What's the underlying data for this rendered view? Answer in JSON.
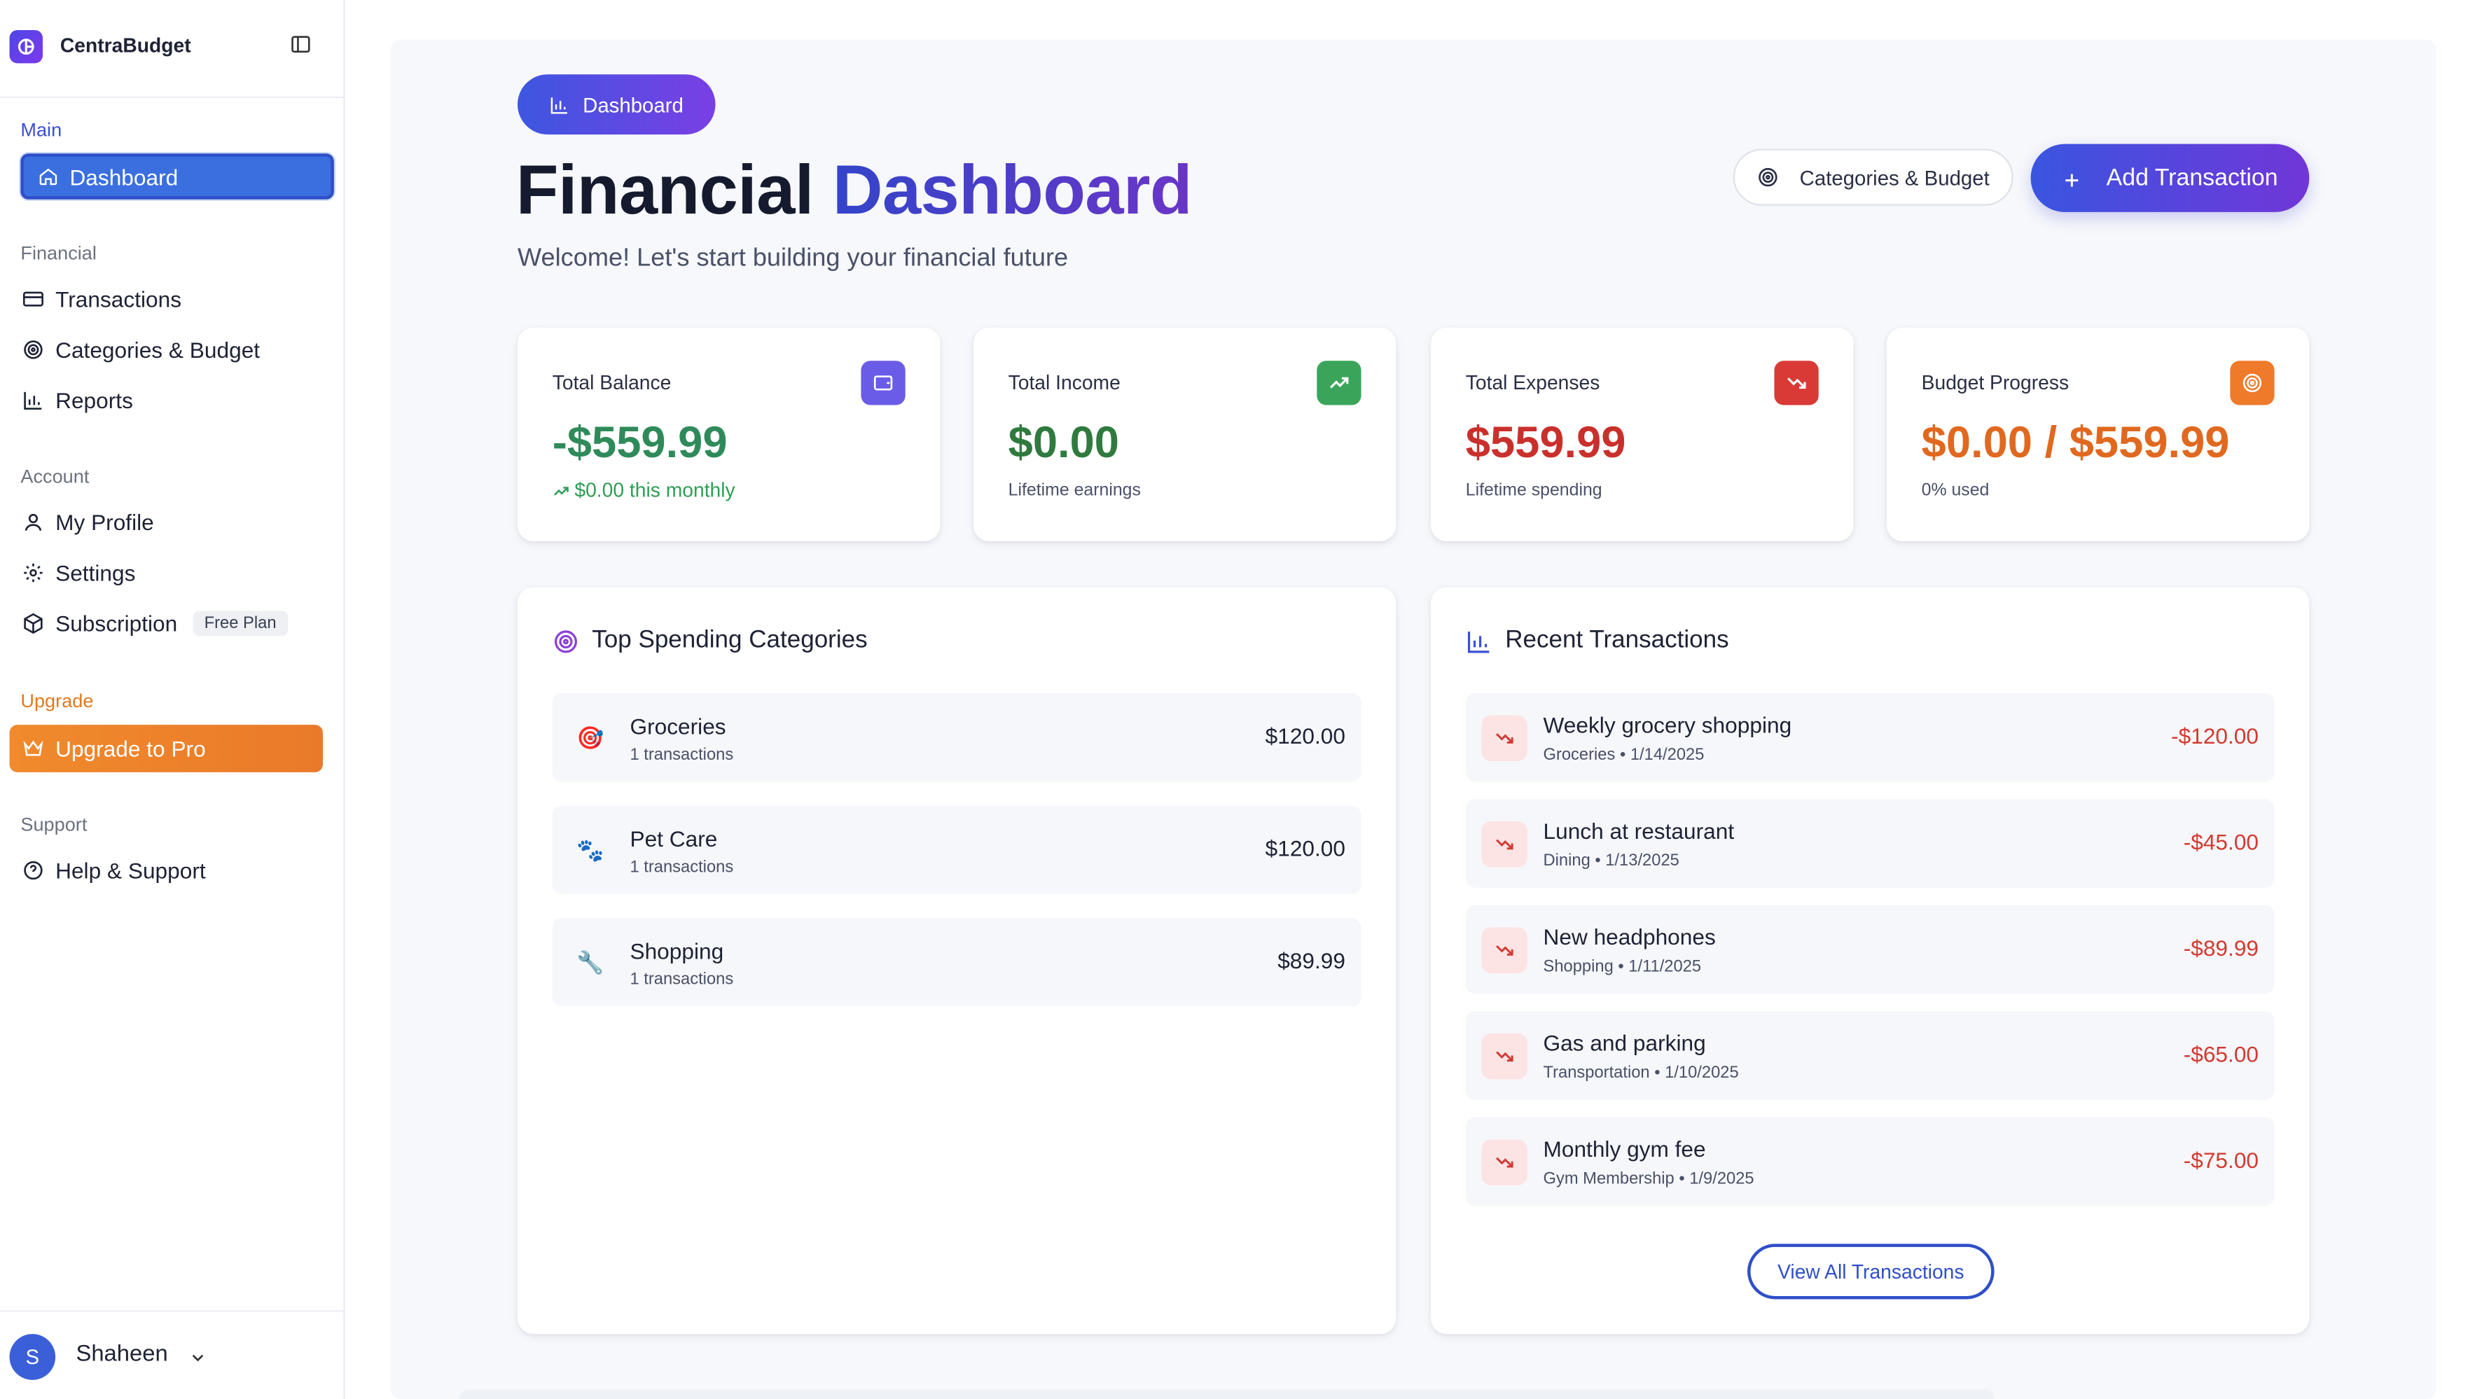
{
  "brand": {
    "name": "CentraBudget"
  },
  "sidebar": {
    "sections": {
      "main": "Main",
      "financial": "Financial",
      "account": "Account",
      "upgrade": "Upgrade",
      "support": "Support"
    },
    "items": {
      "dashboard": "Dashboard",
      "transactions": "Transactions",
      "categories": "Categories & Budget",
      "reports": "Reports",
      "profile": "My Profile",
      "settings": "Settings",
      "subscription": "Subscription",
      "subscription_badge": "Free Plan",
      "upgrade": "Upgrade to Pro",
      "help": "Help & Support"
    },
    "user": {
      "initial": "S",
      "name": "Shaheen"
    }
  },
  "header": {
    "pill": "Dashboard",
    "title_part1": "Financial",
    "title_part2": "Dashboard",
    "subtitle": "Welcome! Let's start building your financial future",
    "categories_button": "Categories & Budget",
    "add_button": "Add Transaction"
  },
  "stats": [
    {
      "label": "Total Balance",
      "value": "-$559.99",
      "sub": "$0.00 this monthly",
      "color": "#2f8a5a",
      "icon_color": "#6b5ce7"
    },
    {
      "label": "Total Income",
      "value": "$0.00",
      "sub": "Lifetime earnings",
      "color": "#2f7a3e",
      "icon_color": "#3aa55a"
    },
    {
      "label": "Total Expenses",
      "value": "$559.99",
      "sub": "Lifetime spending",
      "color": "#c9302c",
      "icon_color": "#d93a36"
    },
    {
      "label": "Budget Progress",
      "value": "$0.00 / $559.99",
      "sub": "0% used",
      "color": "#e0691f",
      "icon_color": "#ef7a2a"
    }
  ],
  "top_categories": {
    "title": "Top Spending Categories",
    "items": [
      {
        "name": "Groceries",
        "count": "1 transactions",
        "amount": "$120.00",
        "emoji": "🎯"
      },
      {
        "name": "Pet Care",
        "count": "1 transactions",
        "amount": "$120.00",
        "emoji": "🐾"
      },
      {
        "name": "Shopping",
        "count": "1 transactions",
        "amount": "$89.99",
        "emoji": "🔧"
      }
    ]
  },
  "recent_transactions": {
    "title": "Recent Transactions",
    "items": [
      {
        "name": "Weekly grocery shopping",
        "meta": "Groceries • 1/14/2025",
        "amount": "-$120.00"
      },
      {
        "name": "Lunch at restaurant",
        "meta": "Dining • 1/13/2025",
        "amount": "-$45.00"
      },
      {
        "name": "New headphones",
        "meta": "Shopping • 1/11/2025",
        "amount": "-$89.99"
      },
      {
        "name": "Gas and parking",
        "meta": "Transportation • 1/10/2025",
        "amount": "-$65.00"
      },
      {
        "name": "Monthly gym fee",
        "meta": "Gym Membership • 1/9/2025",
        "amount": "-$75.00"
      }
    ],
    "view_all": "View All Transactions"
  }
}
